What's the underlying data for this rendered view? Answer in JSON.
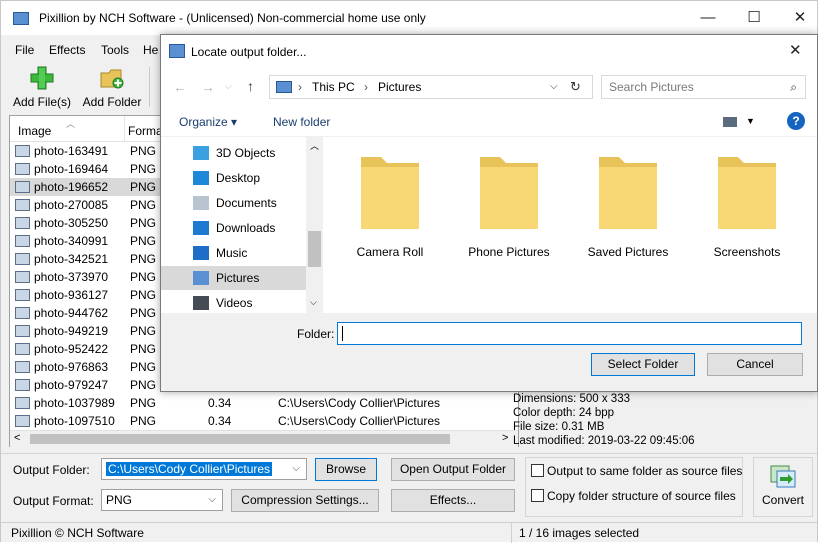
{
  "main_window": {
    "title": "Pixillion by NCH Software - (Unlicensed) Non-commercial home use only",
    "minimize_glyph": "—",
    "maximize_glyph": "☐",
    "close_glyph": "✕"
  },
  "menu": [
    "File",
    "Effects",
    "Tools",
    "He"
  ],
  "toolbar": {
    "add_files": "Add File(s)",
    "add_folder": "Add Folder"
  },
  "list": {
    "columns": [
      "Image",
      "Forma"
    ],
    "rows": [
      {
        "name": "photo-163491",
        "format": "PNG"
      },
      {
        "name": "photo-169464",
        "format": "PNG"
      },
      {
        "name": "photo-196652",
        "format": "PNG",
        "selected": true
      },
      {
        "name": "photo-270085",
        "format": "PNG"
      },
      {
        "name": "photo-305250",
        "format": "PNG"
      },
      {
        "name": "photo-340991",
        "format": "PNG"
      },
      {
        "name": "photo-342521",
        "format": "PNG"
      },
      {
        "name": "photo-373970",
        "format": "PNG"
      },
      {
        "name": "photo-936127",
        "format": "PNG"
      },
      {
        "name": "photo-944762",
        "format": "PNG"
      },
      {
        "name": "photo-949219",
        "format": "PNG"
      },
      {
        "name": "photo-952422",
        "format": "PNG"
      },
      {
        "name": "photo-976863",
        "format": "PNG"
      },
      {
        "name": "photo-979247",
        "format": "PNG"
      },
      {
        "name": "photo-1037989",
        "format": "PNG",
        "size": "0.34",
        "path": "C:\\Users\\Cody Collier\\Pictures"
      },
      {
        "name": "photo-1097510",
        "format": "PNG",
        "size": "0.34",
        "path": "C:\\Users\\Cody Collier\\Pictures"
      }
    ]
  },
  "info": {
    "dimensions": "Dimensions: 500 x 333",
    "color_depth": "Color depth: 24 bpp",
    "file_size": "File size: 0.31 MB",
    "last_modified": "Last modified: 2019-03-22 09:45:06"
  },
  "output": {
    "folder_label": "Output Folder:",
    "folder_value": "C:\\Users\\Cody Collier\\Pictures",
    "browse": "Browse",
    "open_output": "Open Output Folder",
    "format_label": "Output Format:",
    "format_value": "PNG",
    "compression": "Compression Settings...",
    "effects": "Effects...",
    "same_folder": "Output to same folder as source files",
    "copy_structure": "Copy folder structure of source files",
    "convert": "Convert"
  },
  "status": {
    "copyright": "Pixillion © NCH Software",
    "selection": "1 / 16 images selected"
  },
  "dialog": {
    "title": "Locate output folder...",
    "close_glyph": "✕",
    "path": [
      "This PC",
      "Pictures"
    ],
    "search_placeholder": "Search Pictures",
    "organize": "Organize ▾",
    "new_folder": "New folder",
    "help_glyph": "?",
    "nav_items": [
      {
        "label": "3D Objects",
        "icon": "3d-objects-icon",
        "color": "#3aa0e0"
      },
      {
        "label": "Desktop",
        "icon": "desktop-icon",
        "color": "#1e88d8"
      },
      {
        "label": "Documents",
        "icon": "documents-icon",
        "color": "#b8c4d0"
      },
      {
        "label": "Downloads",
        "icon": "downloads-icon",
        "color": "#1e7ad0"
      },
      {
        "label": "Music",
        "icon": "music-icon",
        "color": "#1e6ec8"
      },
      {
        "label": "Pictures",
        "icon": "pictures-icon",
        "color": "#5a8fd1",
        "selected": true
      },
      {
        "label": "Videos",
        "icon": "videos-icon",
        "color": "#444b55"
      }
    ],
    "folders": [
      "Camera Roll",
      "Phone Pictures",
      "Saved Pictures",
      "Screenshots"
    ],
    "folder_label": "Folder:",
    "folder_value": "",
    "select_folder": "Select Folder",
    "cancel": "Cancel"
  },
  "colors": {
    "folder_yellow": "#f8d775",
    "folder_tab": "#e8c35a",
    "accent_blue": "#0078d7",
    "help_blue": "#1565c0"
  }
}
